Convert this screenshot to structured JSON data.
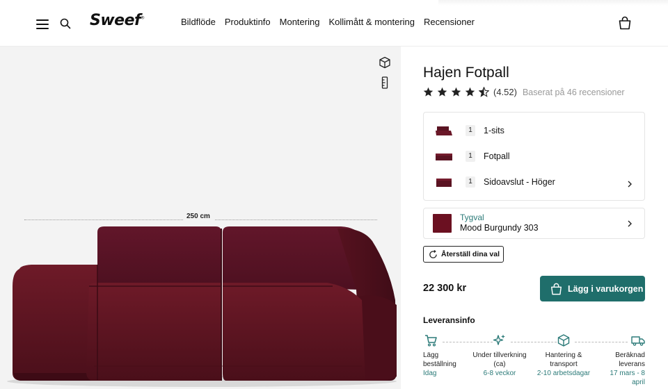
{
  "header": {
    "logo": "Sweef",
    "logo_mark": "®",
    "nav": [
      "Bildflöde",
      "Produktinfo",
      "Montering",
      "Kollimått & montering",
      "Recensioner"
    ]
  },
  "gallery": {
    "dimension_label": "250 cm",
    "view_icons": [
      "3d-cube-icon",
      "ruler-icon"
    ]
  },
  "product": {
    "title": "Hajen Fotpall",
    "rating_score": "(4.52)",
    "rating_value": 4.52,
    "rating_max": 5,
    "rating_count": "Baserat på 46 recensioner",
    "modules": [
      {
        "qty": "1",
        "label": "1-sits"
      },
      {
        "qty": "1",
        "label": "Fotpall"
      },
      {
        "qty": "1",
        "label": "Sidoavslut - Höger"
      }
    ],
    "fabric_category": "Tygval",
    "fabric_name": "Mood Burgundy 303",
    "reset_label": "Återställ dina val",
    "price": "22 300 kr",
    "add_to_cart_label": "Lägg i varukorgen"
  },
  "delivery": {
    "heading": "Leveransinfo",
    "steps": [
      {
        "icon": "cart-icon",
        "title_line1": "Lägg",
        "title_line2": "beställning",
        "sub": "Idag"
      },
      {
        "icon": "sparkle-icon",
        "title_line1": "Under tillverkning",
        "title_line2": "(ca)",
        "sub": "6-8 veckor"
      },
      {
        "icon": "box-icon",
        "title_line1": "Hantering &",
        "title_line2": "transport",
        "sub": "2-10 arbetsdagar"
      },
      {
        "icon": "truck-icon",
        "title_line1": "Beräknad",
        "title_line2": "leverans",
        "sub_line1": "17 mars - 8",
        "sub_line2": "april"
      }
    ]
  },
  "colors": {
    "accent": "#1f6e6b",
    "accent_text": "#2b7a78",
    "fabric": "#6b1021",
    "sofa": "#5c1420"
  }
}
